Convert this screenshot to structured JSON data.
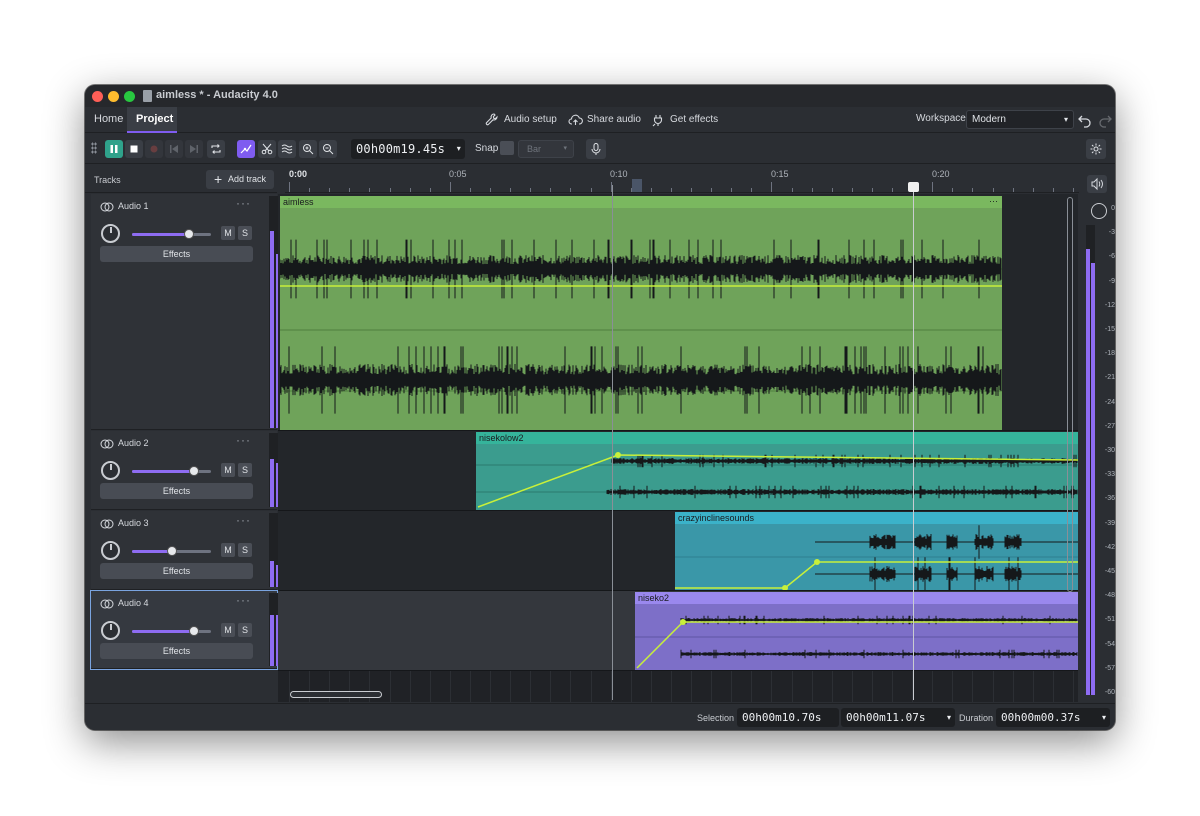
{
  "window": {
    "title": "aimless * - Audacity 4.0"
  },
  "header": {
    "tabs": [
      {
        "label": "Home"
      },
      {
        "label": "Project"
      }
    ],
    "audio_setup": "Audio setup",
    "share_audio": "Share audio",
    "get_effects": "Get effects",
    "workspace_label": "Workspace",
    "workspace_value": "Modern"
  },
  "toolbar": {
    "time": "00h00m19.45s",
    "snap_label": "Snap",
    "snap_value": "Bar"
  },
  "tracks_panel": {
    "label": "Tracks",
    "add_track": "Add track"
  },
  "tracks": [
    {
      "name": "Audio 1",
      "effects": "Effects",
      "mute": "M",
      "solo": "S",
      "volume": 0.72,
      "meter_l": 0.85,
      "meter_r": 0.75
    },
    {
      "name": "Audio 2",
      "effects": "Effects",
      "mute": "M",
      "solo": "S",
      "volume": 0.78,
      "meter_l": 0.65,
      "meter_r": 0.6
    },
    {
      "name": "Audio 3",
      "effects": "Effects",
      "mute": "M",
      "solo": "S",
      "volume": 0.5,
      "meter_l": 0.35,
      "meter_r": 0.3
    },
    {
      "name": "Audio 4",
      "effects": "Effects",
      "mute": "M",
      "solo": "S",
      "volume": 0.78,
      "meter_l": 0.7,
      "meter_r": 0.7
    }
  ],
  "ruler": {
    "labels": [
      "0:00",
      "0:05",
      "0:10",
      "0:15",
      "0:20"
    ]
  },
  "clips": [
    {
      "name": "aimless",
      "menu": "···",
      "color": "#6fa35a",
      "header_color": "#7ab85f"
    },
    {
      "name": "nisekolow2",
      "color": "#3b9c8e",
      "header_color": "#35b49b"
    },
    {
      "name": "crazyinclinesounds",
      "color": "#3a97a8",
      "header_color": "#3bb2c9"
    },
    {
      "name": "niseko2",
      "color": "#7d6fc8",
      "header_color": "#9a88ee"
    }
  ],
  "master_meter": {
    "scale": [
      "0",
      "-3",
      "-6",
      "-9",
      "-12",
      "-15",
      "-18",
      "-21",
      "-24",
      "-27",
      "-30",
      "-33",
      "-36",
      "-39",
      "-42",
      "-45",
      "-48",
      "-51",
      "-54",
      "-57",
      "-60"
    ],
    "level_l": 0.95,
    "level_r": 0.92
  },
  "status": {
    "selection_label": "Selection",
    "selection_start": "00h00m10.70s",
    "selection_end": "00h00m11.07s",
    "duration_label": "Duration",
    "duration": "00h00m00.37s"
  }
}
